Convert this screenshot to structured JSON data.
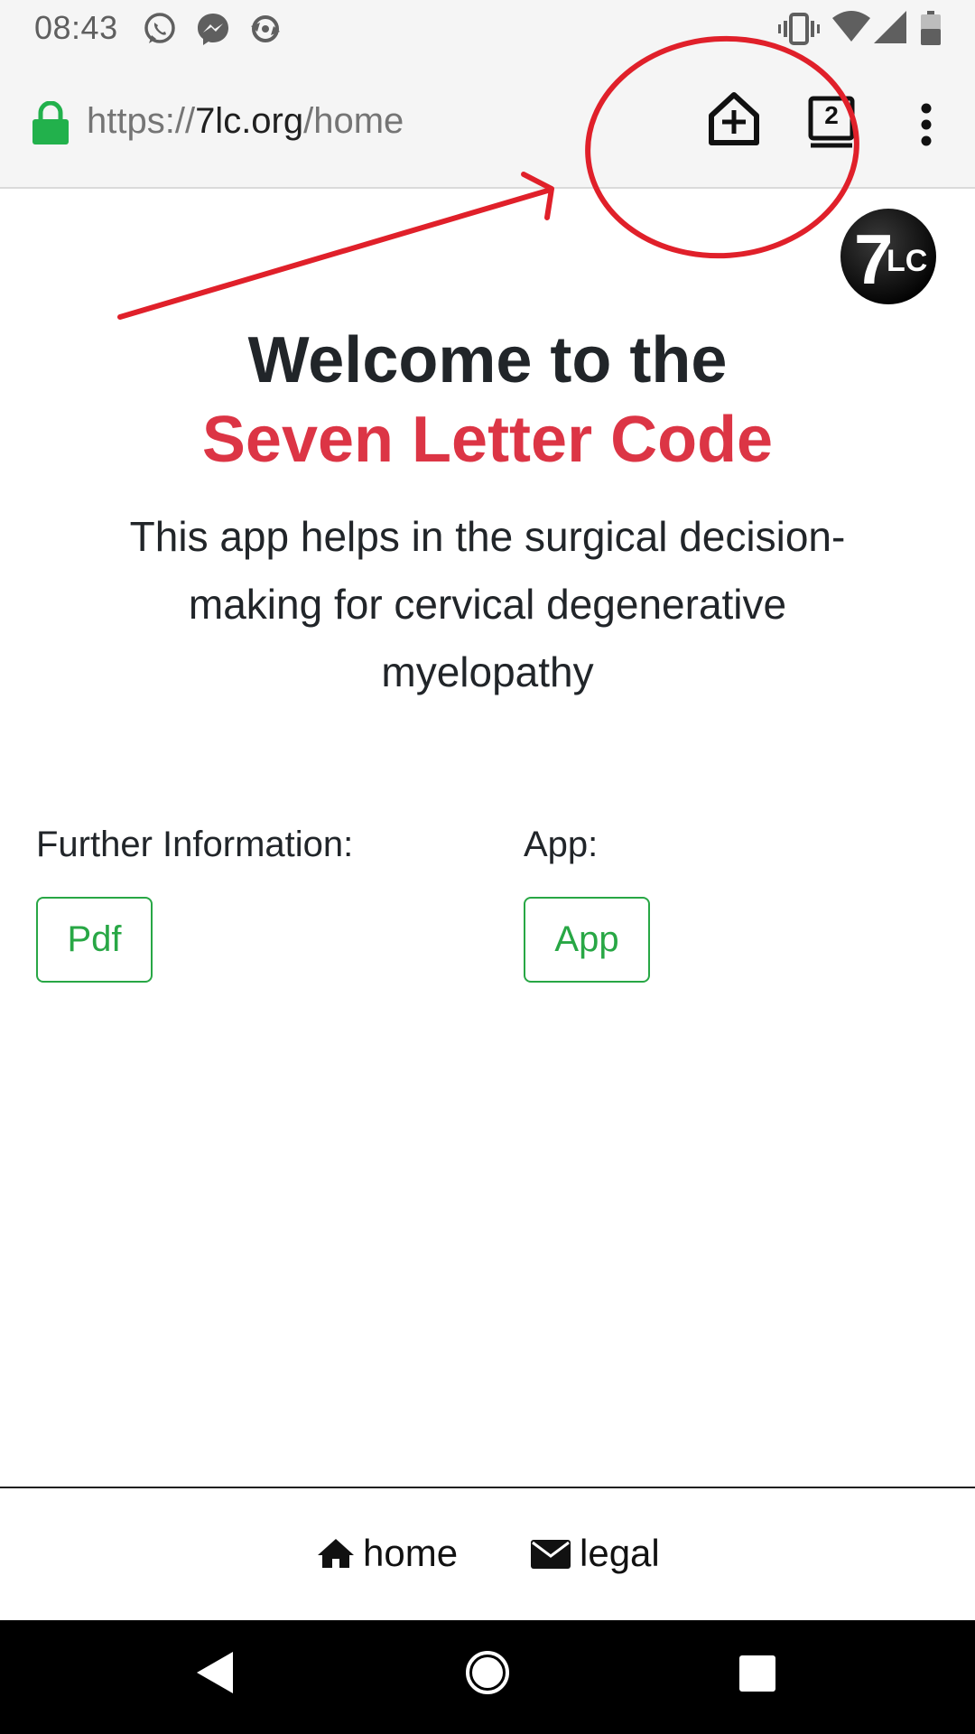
{
  "status_bar": {
    "time": "08:43",
    "left_icons": [
      "whatsapp-icon",
      "messenger-icon",
      "sync-icon"
    ],
    "right_icons": [
      "vibrate-icon",
      "wifi-icon",
      "signal-icon",
      "battery-icon"
    ]
  },
  "browser": {
    "url_scheme": "https://",
    "url_host": "7lc.org",
    "url_path": "/home",
    "tab_count": "2",
    "secure_color": "#22b14c"
  },
  "logo": {
    "numeral": "7",
    "letters": "LC"
  },
  "page": {
    "heading_line1": "Welcome to the",
    "heading_line2": "Seven Letter Code",
    "lead": "This app helps in the surgical decision-making for cervical degenerative myelopathy",
    "further_info_label": "Further Information:",
    "pdf_button": "Pdf",
    "app_label": "App:",
    "app_button": "App"
  },
  "footer": {
    "home_label": "home",
    "legal_label": "legal"
  },
  "colors": {
    "brand_red": "#dc3545",
    "button_green": "#28a745",
    "annotation_red": "#e0202a"
  }
}
